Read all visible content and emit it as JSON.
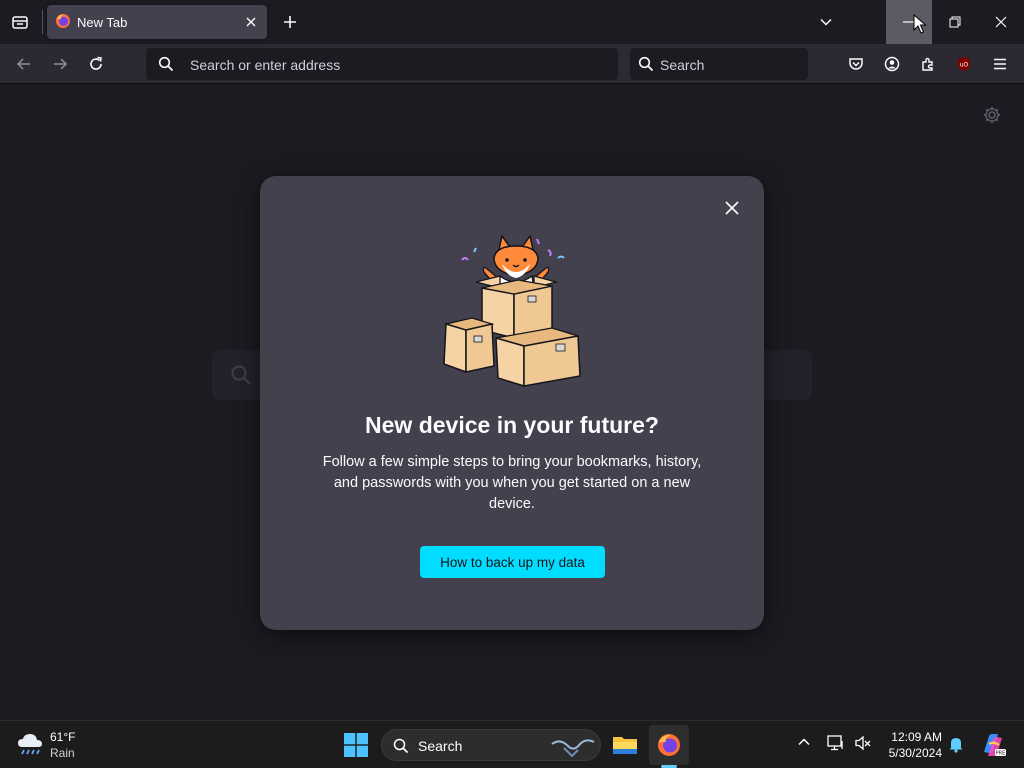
{
  "browser": {
    "tab": {
      "title": "New Tab"
    },
    "urlbar": {
      "placeholder": "Search or enter address"
    },
    "searchbar": {
      "placeholder": "Search"
    },
    "extension_badge": "uO"
  },
  "modal": {
    "title": "New device in your future?",
    "body": "Follow a few simple steps to bring your bookmarks, history, and passwords with you when you get started on a new device.",
    "cta": "How to back up my data"
  },
  "taskbar": {
    "weather": {
      "temp": "61°F",
      "condition": "Rain"
    },
    "search_label": "Search",
    "clock": {
      "time": "12:09 AM",
      "date": "5/30/2024"
    }
  },
  "colors": {
    "accent": "#00ddff",
    "modal_bg": "#42414d",
    "page_bg": "#1c1b22",
    "toolbar_bg": "#2b2a33"
  }
}
